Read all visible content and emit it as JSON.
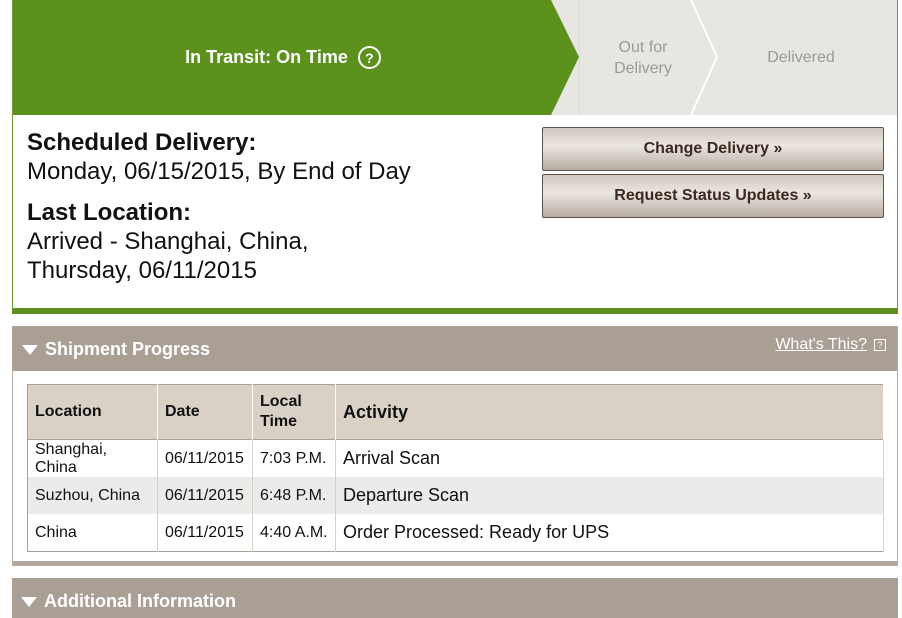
{
  "status": {
    "steps": [
      {
        "label": "In Transit: On Time",
        "state": "current"
      },
      {
        "label_line1": "Out for",
        "label_line2": "Delivery",
        "state": "pending"
      },
      {
        "label": "Delivered",
        "state": "pending"
      }
    ],
    "help_icon": "question-circle-icon",
    "colors": {
      "current": "#5c921c",
      "pending": "#e7e6e2",
      "accent_border": "#5c8f1e"
    }
  },
  "delivery": {
    "scheduled_heading": "Scheduled Delivery:",
    "scheduled_value": "Monday, 06/15/2015, By End of Day",
    "location_heading": "Last Location:",
    "location_line1": "Arrived - Shanghai, China,",
    "location_line2": "Thursday, 06/11/2015"
  },
  "actions": {
    "change_delivery": "Change Delivery »",
    "request_updates": "Request Status Updates »"
  },
  "shipment_progress": {
    "title": "Shipment Progress",
    "whats_this": "What's This?",
    "columns": [
      "Location",
      "Date",
      "Local Time",
      "Activity"
    ],
    "columns_split": {
      "local_time_line1": "Local",
      "local_time_line2": "Time"
    },
    "rows": [
      {
        "location": "Shanghai, China",
        "date": "06/11/2015",
        "time": "7:03 P.M.",
        "activity": "Arrival Scan"
      },
      {
        "location": "Suzhou, China",
        "date": "06/11/2015",
        "time": "6:48 P.M.",
        "activity": "Departure Scan"
      },
      {
        "location": "China",
        "date": "06/11/2015",
        "time": "4:40 A.M.",
        "activity": "Order Processed: Ready for UPS"
      }
    ]
  },
  "additional_info": {
    "title": "Additional Information"
  }
}
